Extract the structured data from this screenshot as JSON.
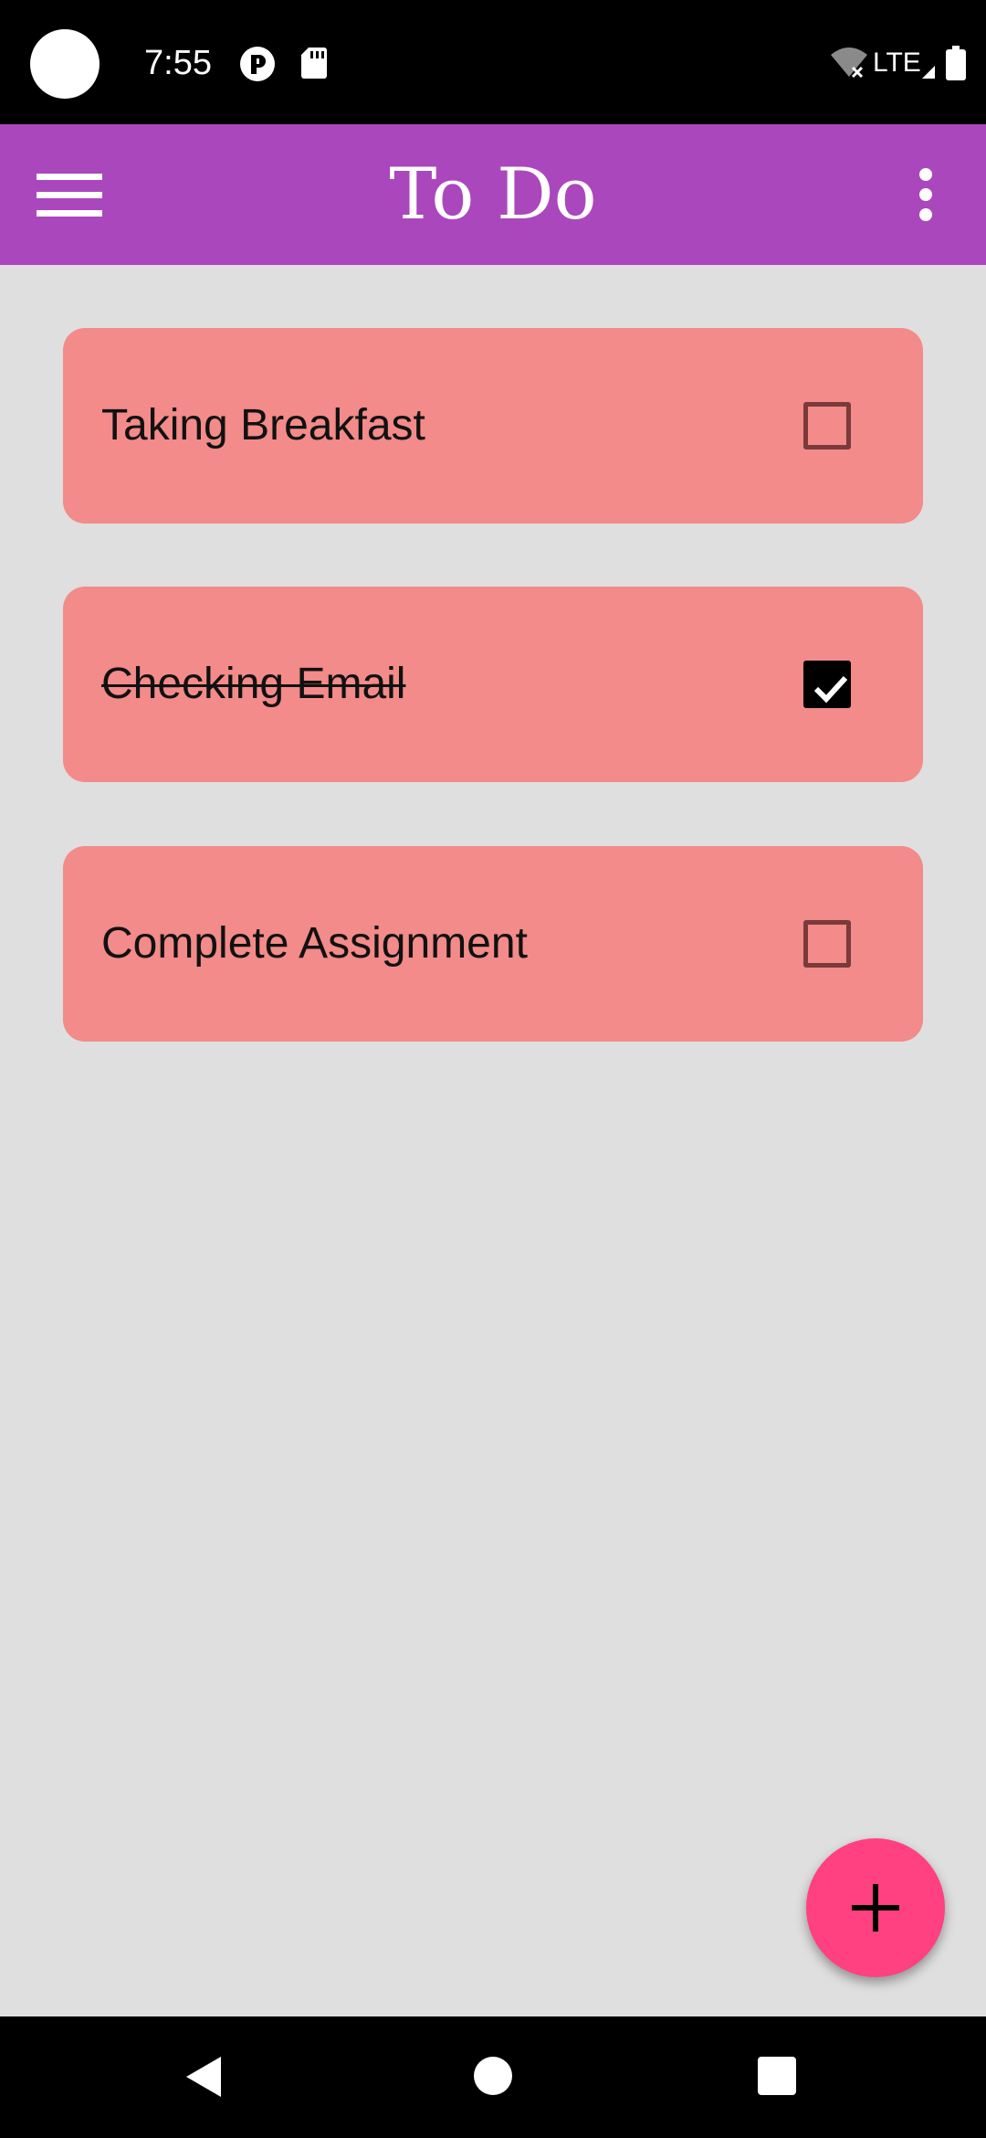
{
  "status_bar": {
    "time": "7:55",
    "network_label": "LTE",
    "icons": [
      "camera-cutout",
      "app-notification-icon",
      "sd-card-icon",
      "wifi-off-icon",
      "signal-icon",
      "battery-icon"
    ]
  },
  "app_bar": {
    "title": "To Do",
    "background_color": "#ab47bc",
    "icons": [
      "menu-icon",
      "more-vert-icon"
    ]
  },
  "todo_list": {
    "card_color": "#f28b89",
    "items": [
      {
        "label": "Taking Breakfast",
        "checked": false
      },
      {
        "label": "Checking Email",
        "checked": true
      },
      {
        "label": "Complete Assignment",
        "checked": false
      }
    ]
  },
  "fab": {
    "icon": "plus-icon",
    "color": "#ff4081"
  },
  "nav_bar": {
    "icons": [
      "back-icon",
      "home-icon",
      "recents-icon"
    ]
  }
}
